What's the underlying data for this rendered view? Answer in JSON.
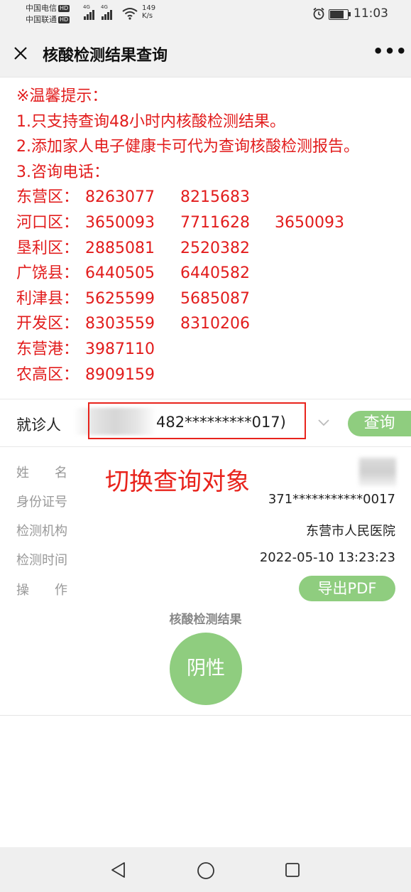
{
  "status_bar": {
    "carrier1": "中国电信",
    "carrier2": "中国联通",
    "hd": "HD",
    "net1": "4G",
    "net2": "4G",
    "speed_value": "149",
    "speed_unit": "K/s",
    "time": "11:03"
  },
  "header": {
    "title": "核酸检测结果查询",
    "more_label": "•••"
  },
  "notice": {
    "lines": [
      "※温馨提示：",
      "1.只支持查询48小时内核酸检测结果。",
      "2.添加家人电子健康卡可代为查询核酸检测报告。",
      "3.咨询电话："
    ],
    "phones": [
      {
        "district": "东营区：",
        "n1": "8263077",
        "n2": "8215683",
        "n3": ""
      },
      {
        "district": "河口区：",
        "n1": "3650093",
        "n2": "7711628",
        "n3": "3650093"
      },
      {
        "district": "垦利区：",
        "n1": "2885081",
        "n2": "2520382",
        "n3": ""
      },
      {
        "district": "广饶县：",
        "n1": "6440505",
        "n2": "6440582",
        "n3": ""
      },
      {
        "district": "利津县：",
        "n1": "5625599",
        "n2": "5685087",
        "n3": ""
      },
      {
        "district": "开发区：",
        "n1": "8303559",
        "n2": "8310206",
        "n3": ""
      },
      {
        "district": "东营港：",
        "n1": "3987110",
        "n2": "",
        "n3": ""
      },
      {
        "district": "农高区：",
        "n1": "8909159",
        "n2": "",
        "n3": ""
      }
    ]
  },
  "patient": {
    "label": "就诊人",
    "selected": "482*********017)",
    "query_button": "查询"
  },
  "annotation": "切换查询对象",
  "details": {
    "name_label": "姓　　名",
    "id_label": "身份证号",
    "id_value": "371***********0017",
    "org_label": "检测机构",
    "org_value": "东营市人民医院",
    "time_label": "检测时间",
    "time_value": "2022-05-10 13:23:23",
    "op_label": "操　　作",
    "export_button": "导出PDF"
  },
  "result": {
    "title": "核酸检测结果",
    "value": "阴性"
  },
  "colors": {
    "notice_red": "#e21c1c",
    "accent_green": "#8fcd7f"
  }
}
